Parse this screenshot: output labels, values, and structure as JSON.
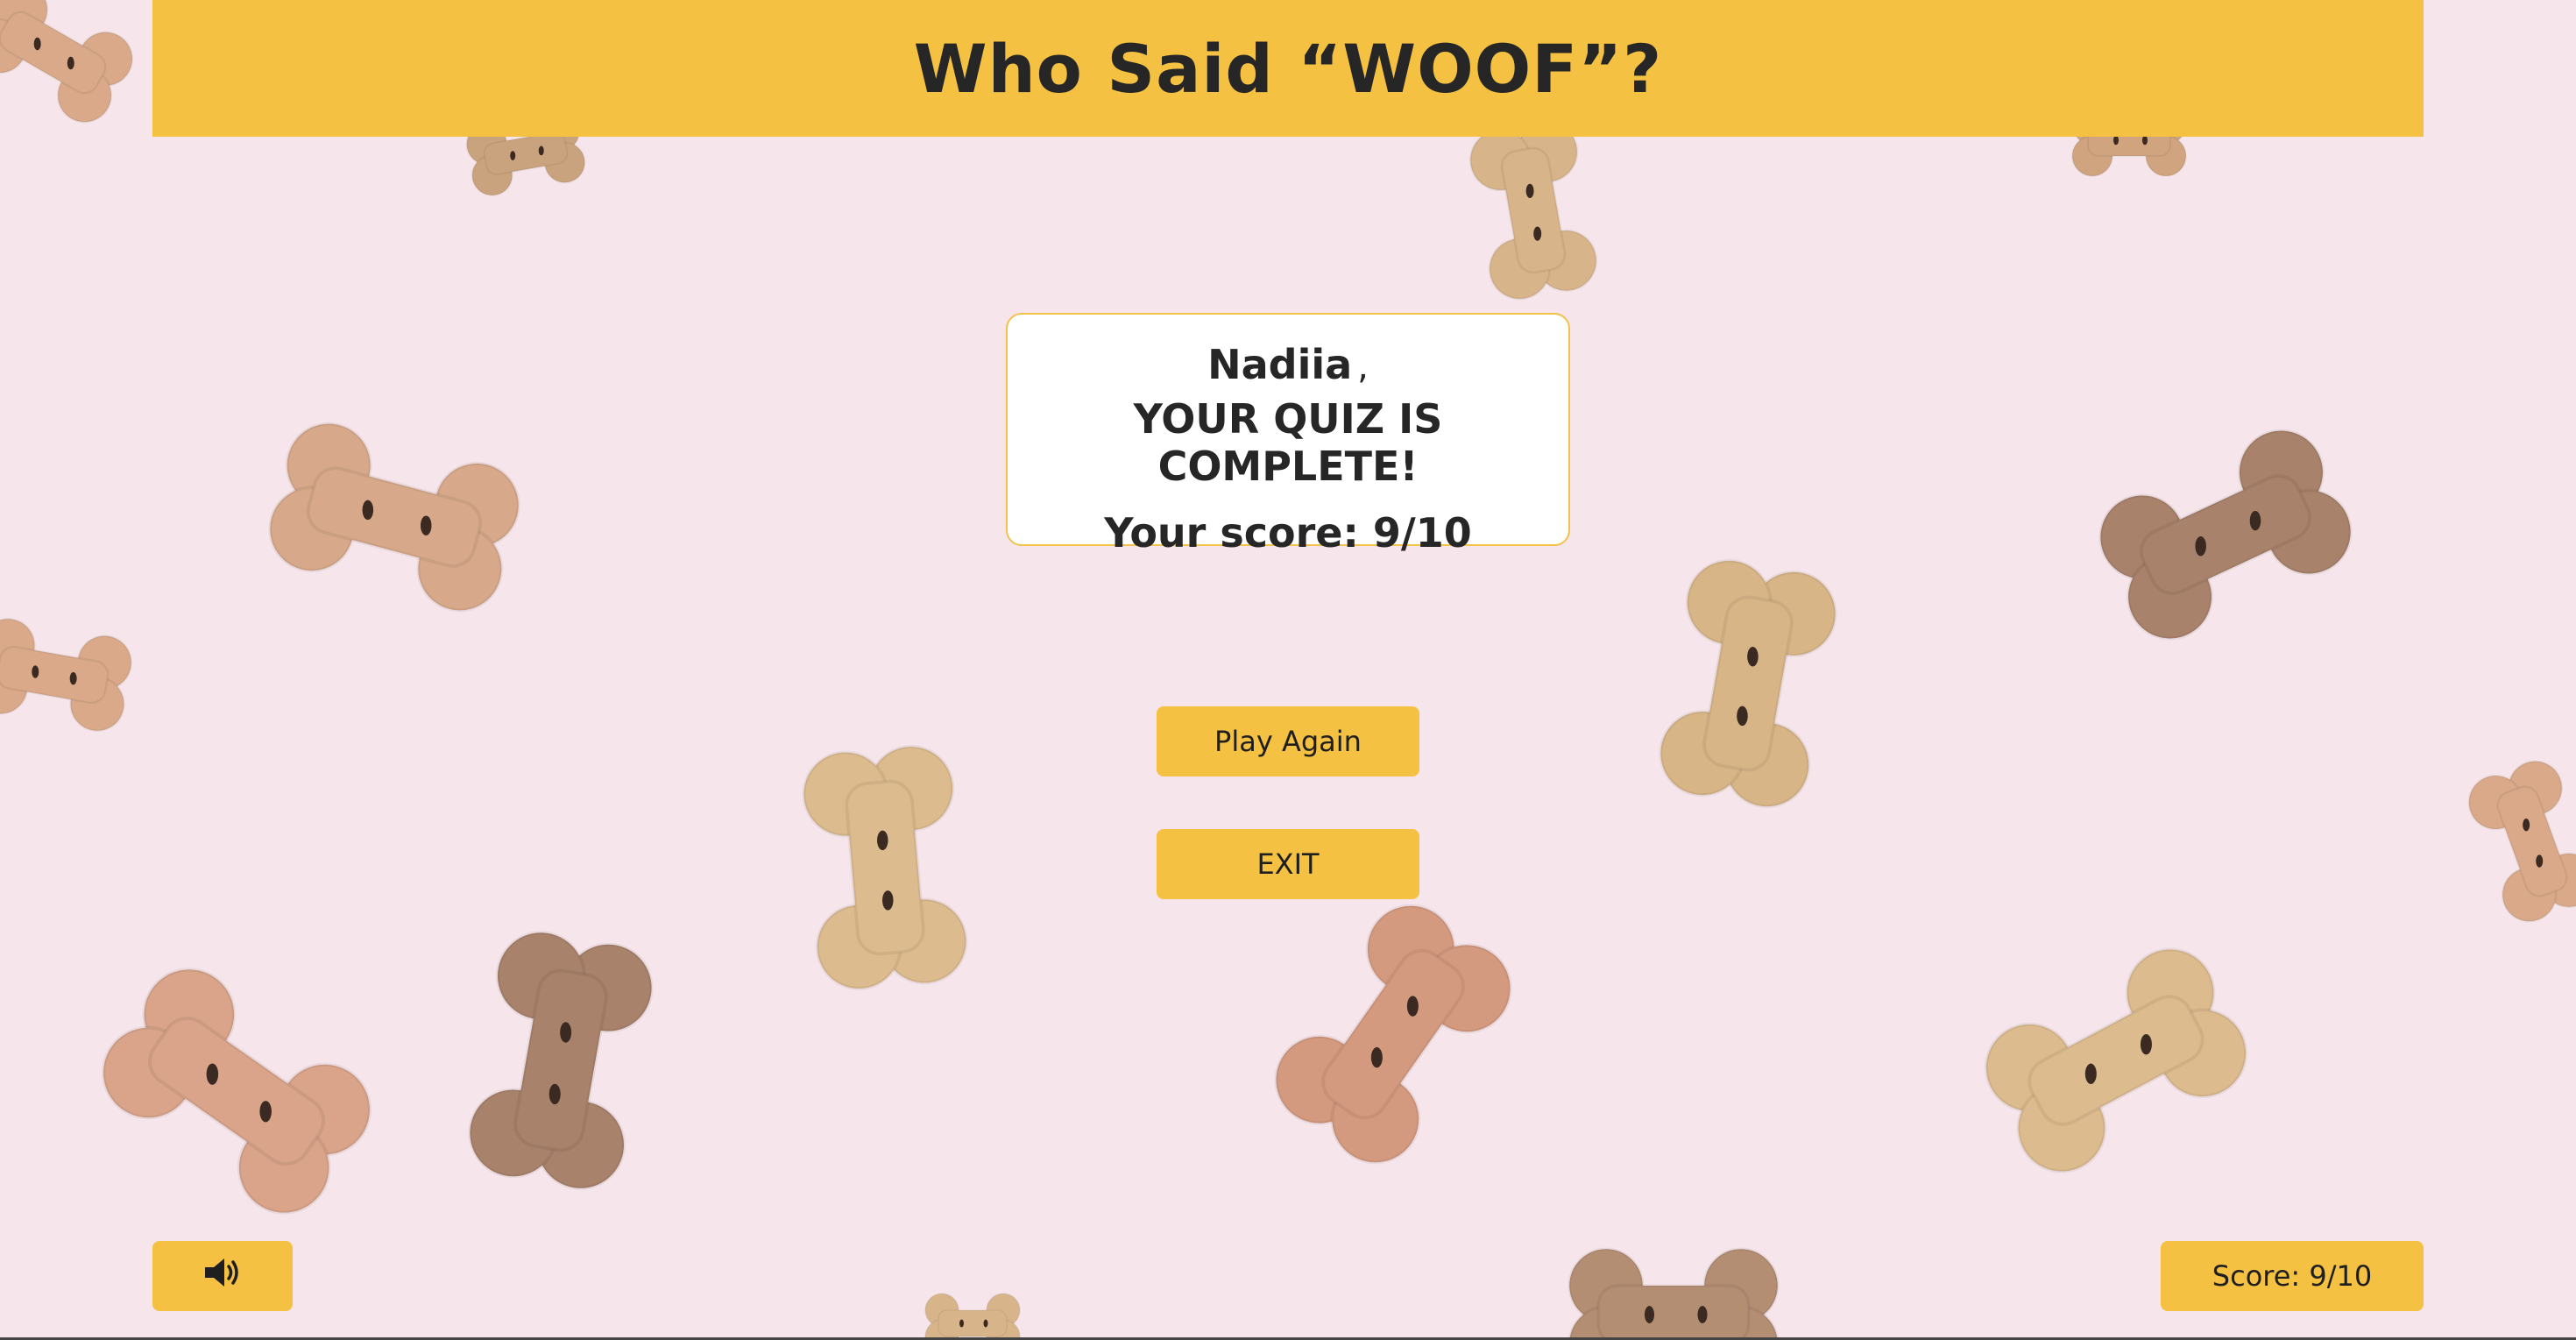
{
  "header": {
    "title": "Who Said “WOOF”?"
  },
  "result": {
    "player_name": "Nadiia",
    "name_suffix": ",",
    "complete_text": "YOUR QUIZ IS COMPLETE!",
    "score_text": "Your score: 9/10"
  },
  "buttons": {
    "play_again": "Play Again",
    "exit": "EXIT",
    "sound_icon": "speaker-volume-icon"
  },
  "footer": {
    "score_label": "Score: 9/10"
  },
  "colors": {
    "accent": "#f4c142",
    "background": "#f6e6ec",
    "text": "#262626"
  }
}
